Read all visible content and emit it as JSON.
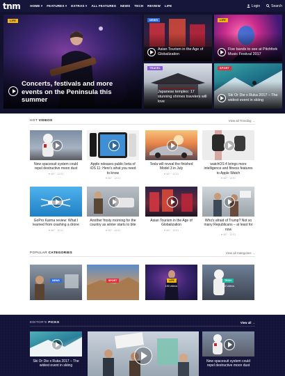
{
  "nav": {
    "logo": "tnm",
    "items": [
      "HOME",
      "FEATURES",
      "EXTRAS",
      "ALL FEATURES",
      "NEWS",
      "TECH",
      "REVIEW",
      "LIFE"
    ],
    "login": "Login",
    "search": "Search"
  },
  "hero": {
    "main": {
      "tag": "LIFE",
      "title": "Concerts, festivals and more events on the Peninsula this summer"
    },
    "tiles": [
      {
        "tag": "NEWS",
        "title": "Asian Tourism in the Age of Globalization"
      },
      {
        "tag": "LIFE",
        "title": "Five bands to see at Pitchfork Music Festival 2017"
      },
      {
        "tag": "TRAVEL",
        "title": "Japanese temples: 17 stunning shrines travelers will love"
      },
      {
        "tag": "SPORT",
        "title": "Ski Or Die x Ruka 2017 – The widest event in skiing"
      }
    ]
  },
  "hot_videos": {
    "title_light": "HOT",
    "title_bold": "VIDEOS",
    "view_all": "View all Trending →",
    "cards": [
      {
        "title": "New spacesuit system could repel destructive moon dust",
        "meta": "♥ 467 · 12:01"
      },
      {
        "title": "Apple releases public beta of iOS 11: Here's what you need to know",
        "meta": "♥ 467 · 12:01"
      },
      {
        "title": "Tesla will reveal the finished Model 3 in July",
        "meta": "♥ 467 · 12:01"
      },
      {
        "title": "watchOS 4 brings more intelligence and fitness features to Apple Watch",
        "meta": "♥ 467 · 12:01"
      },
      {
        "title": "GoPro Karma review: What I learned from crashing a drone",
        "meta": "♥ 467 · 12:01"
      },
      {
        "title": "Another frosty morning for the country as winter starts to bite",
        "meta": "♥ 467 · 12:01"
      },
      {
        "title": "Asian Tourism in the Age of Globalization",
        "meta": "♥ 467 · 12:01"
      },
      {
        "title": "Who's afraid of Trump? Not so many Republicans – at least for now",
        "meta": "♥ 467 · 12:01"
      }
    ]
  },
  "popular": {
    "title_light": "POPULAR",
    "title_bold": "CATEGORIES",
    "view_all": "View all Categories →",
    "categories": [
      {
        "tag": "NEWS",
        "count": ""
      },
      {
        "tag": "SPORT",
        "count": ""
      },
      {
        "tag": "LIFE",
        "count": "150 videos"
      },
      {
        "tag": "TECH",
        "count": "150 videos"
      }
    ]
  },
  "picks": {
    "title_light": "EDITOR'S",
    "title_bold": "PICKS",
    "view_all": "View all →",
    "left": {
      "title": "Ski Or Die x Ruka 2017 – The widest event in skiing"
    },
    "right": {
      "title": "New spacesuit system could repel destructive moon dust"
    }
  },
  "colors": {
    "nav_bg": "#16153a",
    "accent_pink": "#e8246e",
    "tag_news": "#2f6de0",
    "tag_life": "#f2b713",
    "tag_sport": "#e62b3a",
    "tag_travel": "#8a5bd6",
    "tag_tech": "#1fb8a0"
  }
}
